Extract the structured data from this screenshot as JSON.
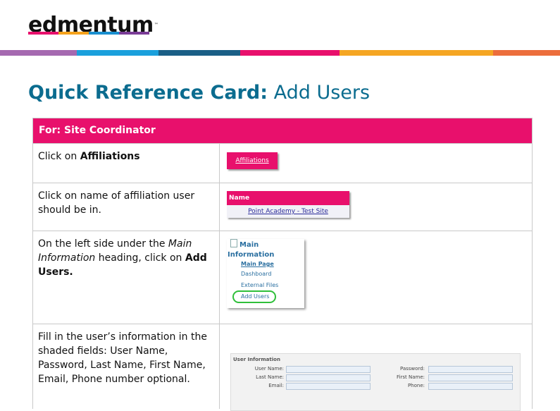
{
  "logo": {
    "text": "edmentum",
    "tm": "™"
  },
  "logo_stripe_colors": [
    "#e8106c",
    "#f5a21b",
    "#1a8fcf",
    "#7a3c96"
  ],
  "band_colors": [
    "#a569b0",
    "#1aa0dc",
    "#1a5f86",
    "#e8106c",
    "#f5a623",
    "#ec6e3c"
  ],
  "title": {
    "bold": "Quick Reference Card:",
    "rest": " Add Users"
  },
  "accent": "#e8106c",
  "table": {
    "header": "For: Site Coordinator",
    "rows": [
      {
        "text_before": "Click on ",
        "bold": "Affiliations",
        "image_button": "Affiliations"
      },
      {
        "text": "Click on name of affiliation user should be in.",
        "image_header": "Name",
        "image_link": "Point Academy - Test Site"
      },
      {
        "text_before": "On the left side under the ",
        "italic": "Main Information",
        "text_middle": " heading, click on ",
        "bold": "Add Users.",
        "image_heading": "Main Information",
        "image_items": [
          "Main Page",
          "Dashboard",
          "External Files",
          "Add Users"
        ]
      },
      {
        "text": "Fill in the user’s information in the shaded fields: User Name, Password, Last Name, First Name, Email, Phone number optional.",
        "image_title": "User Information",
        "image_labels_left": [
          "User Name:",
          "Last Name:",
          "Email:"
        ],
        "image_labels_right": [
          "Password:",
          "First Name:",
          "Phone:"
        ]
      }
    ]
  }
}
